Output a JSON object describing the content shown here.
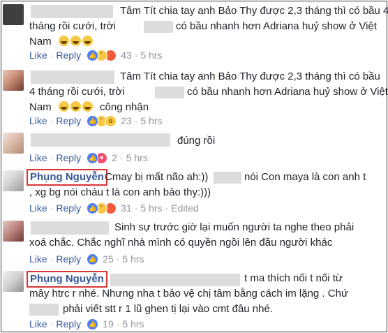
{
  "actions": {
    "like": "Like",
    "reply": "Reply",
    "separator": "·",
    "edited": "Edited"
  },
  "comments": [
    {
      "line1": "Tâm Tít chia tay anh Bảo Thy được 2,3 tháng thì có bầu 4",
      "line2_a": "tháng rồi cưới, trời",
      "line2_b": "có bầu nhanh hơn Adriana huỷ show ở Việt",
      "line3": "Nam",
      "line3_tail": "",
      "reactions": [
        "like-icon",
        "haha-icon",
        "angry-icon"
      ],
      "count": "43",
      "time": "5 hrs"
    },
    {
      "line1": "Tâm Tít chia tay anh Bảo Thy được 2,3 tháng thì có bầu",
      "line2_a": "4 tháng rồi cưới, trời",
      "line2_b": "có bầu nhanh hơn Adriana huỷ show ở Việt",
      "line3": "Nam",
      "line3_tail": "công nhận",
      "reactions": [
        "like-icon",
        "haha-icon",
        "wow-icon"
      ],
      "count": "23",
      "time": "5 hrs"
    },
    {
      "line1": "đúng rồi",
      "reactions": [
        "like-icon",
        "love-icon"
      ],
      "count": "2",
      "time": "5 hrs"
    },
    {
      "name": "Phụng Nguyễn",
      "line1_a": "Cmay bị mất não ah:))",
      "line1_b": "nói Con maya là con anh t",
      "line2": ", xg bg nói cháu t là con anh bảo thy:)))",
      "reactions": [
        "like-icon",
        "haha-icon",
        "angry-icon"
      ],
      "count": "31",
      "time": "5 hrs",
      "edited": "Edited"
    },
    {
      "line1": "Sinh sự trước giờ lại muốn người ta nghe theo phải",
      "line2": "xoá chắc. Chắc nghĩ nhà mình có quyền ngồi lên đầu người khác",
      "reactions": [
        "like-icon"
      ],
      "count": "25",
      "time": "5 hrs"
    },
    {
      "name": "Phụng Nguyễn",
      "line1": "t ma thích nối t nối từ",
      "line2": "mây htrc r nhé. Nhưng nha t bảo vệ chị tâm bằng cách im lặng . Chứ",
      "line3": "phải viết stt r 1 lũ ghen tị lại vào cmt đâu nhé.",
      "reactions": [
        "like-icon"
      ],
      "count": "19",
      "time": "5 hrs"
    }
  ]
}
